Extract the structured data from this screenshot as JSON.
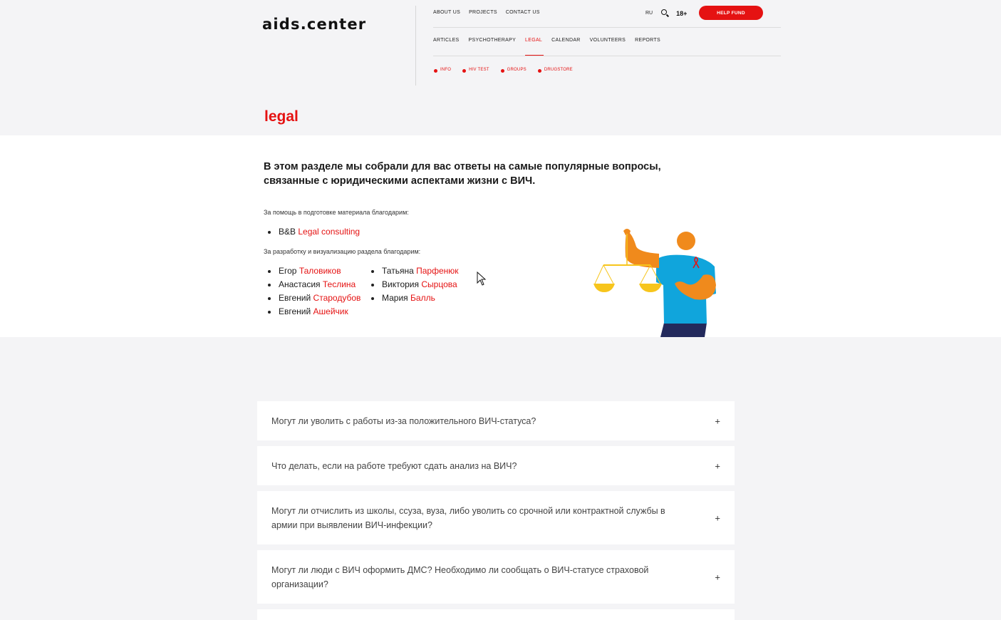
{
  "header": {
    "logo": "aids.center",
    "top_nav": [
      "ABOUT US",
      "PROJECTS",
      "CONTACT US"
    ],
    "lang": "RU",
    "age_rating": "18+",
    "help_button": "HELP FUND",
    "section_nav": [
      "ARTICLES",
      "PSYCHOTHERAPY",
      "LEGAL",
      "CALENDAR",
      "VOLUNTEERS",
      "REPORTS"
    ],
    "active_section": "LEGAL",
    "sub_nav": [
      "INFO",
      "HIV TEST",
      "GROUPS",
      "DRUGSTORE"
    ]
  },
  "page": {
    "title": "legal",
    "lead": "В этом разделе мы собрали для вас ответы на самые популярные вопросы, связанные с юридическими аспектами жизни с ВИЧ.",
    "thanks_material": "За помощь в подготовке материала благодарим:",
    "material_credits": [
      {
        "first": "B&B",
        "last": "Legal consulting"
      }
    ],
    "thanks_design": "За разработку и визуализацию раздела благодарим:",
    "design_credits_col1": [
      {
        "first": "Егор",
        "last": "Таловиков"
      },
      {
        "first": "Анастасия",
        "last": "Теслина"
      },
      {
        "first": "Евгений",
        "last": "Стародубов"
      },
      {
        "first": "Евгений",
        "last": "Ашейчик"
      }
    ],
    "design_credits_col2": [
      {
        "first": "Татьяна",
        "last": "Парфенюк"
      },
      {
        "first": "Виктория",
        "last": "Сырцова"
      },
      {
        "first": "Мария",
        "last": "Балль"
      }
    ]
  },
  "faq": [
    {
      "q": "Могут ли уволить с работы из-за положительного ВИЧ-статуса?",
      "icon": "+"
    },
    {
      "q": "Что делать, если на работе требуют сдать анализ на ВИЧ?",
      "icon": "+"
    },
    {
      "q": "Могут ли отчислить из школы, ссуза, вуза, либо уволить со срочной или контрактной службы в армии при выявлении ВИЧ-инфекции?",
      "icon": "+"
    },
    {
      "q": "Могут ли люди с ВИЧ оформить ДМС? Необходимо ли сообщать о ВИЧ-статусе страховой организации?",
      "icon": "+"
    }
  ],
  "colors": {
    "accent": "#e51212",
    "bg": "#f4f4f6",
    "illus_orange": "#f08a1c",
    "illus_blue": "#10a5dc",
    "illus_yellow": "#f7c51c",
    "illus_navy": "#232a5c"
  }
}
